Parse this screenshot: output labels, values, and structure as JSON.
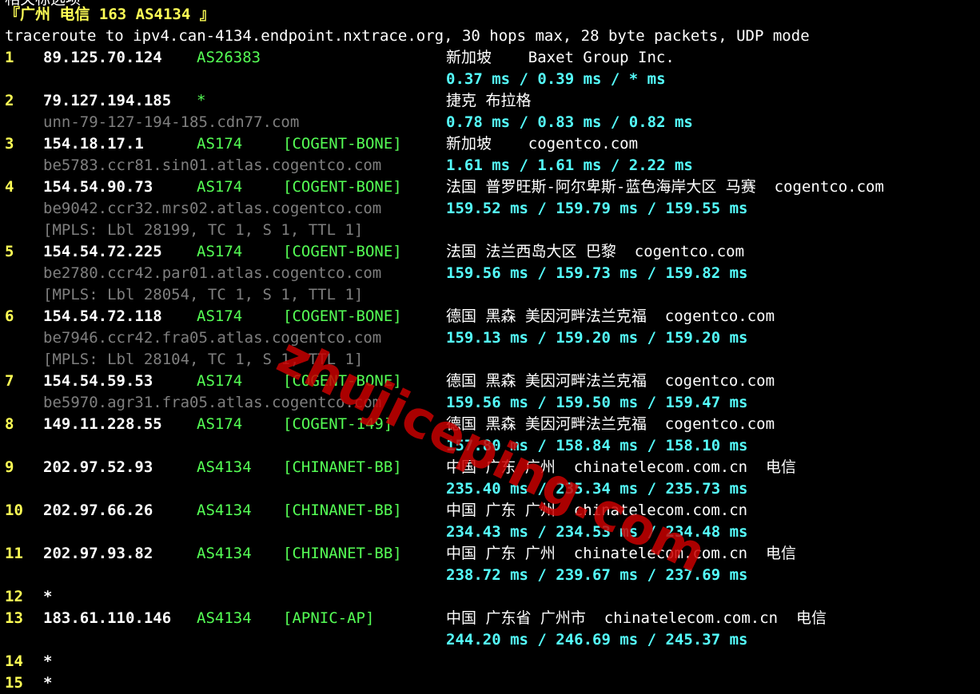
{
  "top_partial_text": "相关标选项",
  "header": {
    "title": "『广州 电信 163 AS4134 』",
    "command": "traceroute to ipv4.can-4134.endpoint.nxtrace.org, 30 hops max, 28 byte packets, UDP mode"
  },
  "hops": [
    {
      "num": "1",
      "ip": "89.125.70.124",
      "asn": "AS26383",
      "tag": "",
      "geo": "新加坡    Baxet Group Inc.",
      "host": "",
      "mpls": "",
      "rtt": "0.37 ms / 0.39 ms / * ms"
    },
    {
      "num": "2",
      "ip": "79.127.194.185",
      "asn": "*",
      "tag": "",
      "geo": "捷克 布拉格",
      "host": "unn-79-127-194-185.cdn77.com",
      "mpls": "",
      "rtt": "0.78 ms / 0.83 ms / 0.82 ms"
    },
    {
      "num": "3",
      "ip": "154.18.17.1",
      "asn": "AS174",
      "tag": "[COGENT-BONE]",
      "geo": "新加坡    cogentco.com",
      "host": "be5783.ccr81.sin01.atlas.cogentco.com",
      "mpls": "",
      "rtt": "1.61 ms / 1.61 ms / 2.22 ms"
    },
    {
      "num": "4",
      "ip": "154.54.90.73",
      "asn": "AS174",
      "tag": "[COGENT-BONE]",
      "geo": "法国 普罗旺斯-阿尔卑斯-蓝色海岸大区 马赛  cogentco.com",
      "host": "be9042.ccr32.mrs02.atlas.cogentco.com",
      "mpls": "[MPLS: Lbl 28199, TC 1, S 1, TTL 1]",
      "rtt": "159.52 ms / 159.79 ms / 159.55 ms"
    },
    {
      "num": "5",
      "ip": "154.54.72.225",
      "asn": "AS174",
      "tag": "[COGENT-BONE]",
      "geo": "法国 法兰西岛大区 巴黎  cogentco.com",
      "host": "be2780.ccr42.par01.atlas.cogentco.com",
      "mpls": "[MPLS: Lbl 28054, TC 1, S 1, TTL 1]",
      "rtt": "159.56 ms / 159.73 ms / 159.82 ms"
    },
    {
      "num": "6",
      "ip": "154.54.72.118",
      "asn": "AS174",
      "tag": "[COGENT-BONE]",
      "geo": "德国 黑森 美因河畔法兰克福  cogentco.com",
      "host": "be7946.ccr42.fra05.atlas.cogentco.com",
      "mpls": "[MPLS: Lbl 28104, TC 1, S 1, TTL 1]",
      "rtt": "159.13 ms / 159.20 ms / 159.20 ms"
    },
    {
      "num": "7",
      "ip": "154.54.59.53",
      "asn": "AS174",
      "tag": "[COGENT-BONE]",
      "geo": "德国 黑森 美因河畔法兰克福  cogentco.com",
      "host": "be5970.agr31.fra05.atlas.cogentco.com",
      "mpls": "",
      "rtt": "159.56 ms / 159.50 ms / 159.47 ms"
    },
    {
      "num": "8",
      "ip": "149.11.228.55",
      "asn": "AS174",
      "tag": "[COGENT-149]",
      "geo": "德国 黑森 美因河畔法兰克福  cogentco.com",
      "host": "",
      "mpls": "",
      "rtt": "157.80 ms / 158.84 ms / 158.10 ms"
    },
    {
      "num": "9",
      "ip": "202.97.52.93",
      "asn": "AS4134",
      "tag": "[CHINANET-BB]",
      "geo": "中国 广东 广州  chinatelecom.com.cn  电信",
      "host": "",
      "mpls": "",
      "rtt": "235.40 ms / 235.34 ms / 235.73 ms"
    },
    {
      "num": "10",
      "ip": "202.97.66.26",
      "asn": "AS4134",
      "tag": "[CHINANET-BB]",
      "geo": "中国 广东 广州  chinatelecom.com.cn",
      "host": "",
      "mpls": "",
      "rtt": "234.43 ms / 234.53 ms / 234.48 ms"
    },
    {
      "num": "11",
      "ip": "202.97.93.82",
      "asn": "AS4134",
      "tag": "[CHINANET-BB]",
      "geo": "中国 广东 广州  chinatelecom.com.cn  电信",
      "host": "",
      "mpls": "",
      "rtt": "238.72 ms / 239.67 ms / 237.69 ms"
    },
    {
      "num": "12",
      "star": "*"
    },
    {
      "num": "13",
      "ip": "183.61.110.146",
      "asn": "AS4134",
      "tag": "[APNIC-AP]",
      "geo": "中国 广东省 广州市  chinatelecom.com.cn  电信",
      "host": "",
      "mpls": "",
      "rtt": "244.20 ms / 246.69 ms / 245.37 ms"
    },
    {
      "num": "14",
      "star": "*"
    },
    {
      "num": "15",
      "star": "*"
    }
  ],
  "watermark": "zhujiceping.com",
  "colors": {
    "background": "#000000",
    "hop_number": "#ffff55",
    "asn_tag": "#55ff55",
    "rtt": "#55ffff",
    "hostname": "#7f7f7f",
    "watermark": "#c80000"
  }
}
